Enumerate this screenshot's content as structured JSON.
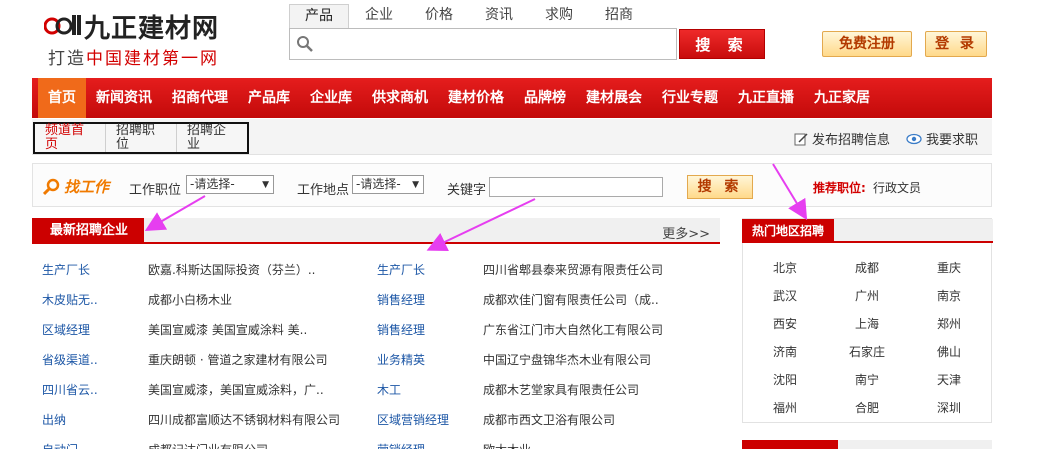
{
  "header": {
    "logo_name": "九正建材网",
    "slogan_prefix": "打造",
    "slogan_highlight": "中国建材第一网",
    "register_label": "免费注册",
    "login_label": "登 录"
  },
  "search": {
    "tabs": [
      "产品",
      "企业",
      "价格",
      "资讯",
      "求购",
      "招商"
    ],
    "placeholder": "",
    "button_label": "搜 索"
  },
  "nav": {
    "items": [
      "首页",
      "新闻资讯",
      "招商代理",
      "产品库",
      "企业库",
      "供求商机",
      "建材价格",
      "品牌榜",
      "建材展会",
      "行业专题",
      "九正直播",
      "九正家居"
    ]
  },
  "subnav": {
    "items": [
      "频道首页",
      "招聘职位",
      "招聘企业"
    ],
    "post_label": "发布招聘信息",
    "seek_label": "我要求职"
  },
  "jobbar": {
    "title": "找工作",
    "position_label": "工作职位",
    "position_value": "-请选择-",
    "location_label": "工作地点",
    "location_value": "-请选择-",
    "keyword_label": "关键字",
    "button_label": "搜 索",
    "recommend_label": "推荐职位:",
    "recommend_value": "行政文员"
  },
  "latest": {
    "title": "最新招聘企业",
    "more_label": "更多>>",
    "left": [
      {
        "job": "生产厂长",
        "company": "欧嘉.科斯达国际投资（芬兰）.."
      },
      {
        "job": "木皮贴无..",
        "company": "成都小白杨木业"
      },
      {
        "job": "区域经理",
        "company": "美国宣威漆 美国宣威涂料 美.."
      },
      {
        "job": "省级渠道..",
        "company": "重庆朗顿 · 管道之家建材有限公司"
      },
      {
        "job": "四川省云..",
        "company": "美国宣威漆，美国宣威涂料，广.."
      },
      {
        "job": "出纳",
        "company": "四川成都富顺达不锈钢材料有限公司"
      },
      {
        "job": "自动门..",
        "company": "成都记达门业有限公司"
      }
    ],
    "right": [
      {
        "job": "生产厂长",
        "company": "四川省郫县泰来贸源有限责任公司"
      },
      {
        "job": "销售经理",
        "company": "成都欢佳门窗有限责任公司（成.."
      },
      {
        "job": "销售经理",
        "company": "广东省江门市大自然化工有限公司"
      },
      {
        "job": "业务精英",
        "company": "中国辽宁盘锦华杰木业有限公司"
      },
      {
        "job": "木工",
        "company": "成都木艺堂家具有限责任公司"
      },
      {
        "job": "区域营销经理",
        "company": "成都市西文卫浴有限公司"
      },
      {
        "job": "营销经理",
        "company": "欧太木业"
      }
    ]
  },
  "hot": {
    "title": "热门地区招聘",
    "cities": [
      "北京",
      "成都",
      "重庆",
      "武汉",
      "广州",
      "南京",
      "西安",
      "上海",
      "郑州",
      "济南",
      "石家庄",
      "佛山",
      "沈阳",
      "南宁",
      "天津",
      "福州",
      "合肥",
      "深圳"
    ]
  },
  "colors": {
    "brand_red": "#cc0000",
    "nav_active": "#f06a1a",
    "link_blue": "#1d57a6",
    "annotation_magenta": "#e63ef0"
  }
}
